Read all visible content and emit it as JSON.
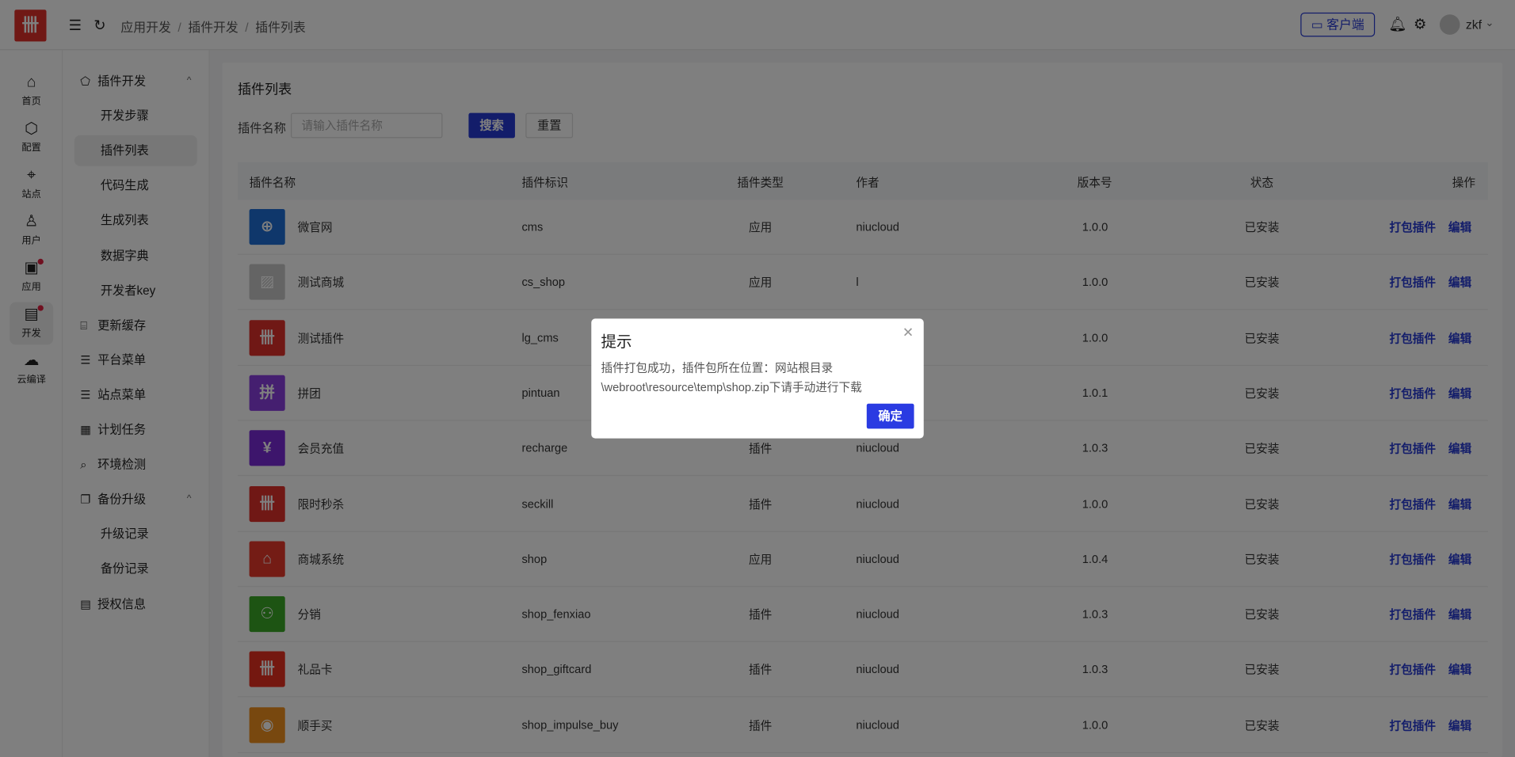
{
  "header": {
    "logo": "卌",
    "breadcrumb": [
      "应用开发",
      "插件开发",
      "插件列表"
    ],
    "client_button": "客户端",
    "username": "zkf"
  },
  "iconbar": [
    {
      "label": "首页",
      "icon": "home-icon",
      "glyph": "⌂"
    },
    {
      "label": "配置",
      "icon": "settings-hex-icon",
      "glyph": "⬡"
    },
    {
      "label": "站点",
      "icon": "location-icon",
      "glyph": "⌖"
    },
    {
      "label": "用户",
      "icon": "user-icon",
      "glyph": "♙"
    },
    {
      "label": "应用",
      "icon": "apps-icon",
      "glyph": "▣",
      "dot": true
    },
    {
      "label": "开发",
      "icon": "dev-icon",
      "glyph": "▤",
      "dot": true,
      "active": true
    },
    {
      "label": "云编译",
      "icon": "cloud-icon",
      "glyph": "☁"
    }
  ],
  "menu": [
    {
      "label": "插件开发",
      "type": "top",
      "icon": "plugin-icon",
      "glyph": "⬠",
      "caret": "^"
    },
    {
      "label": "开发步骤",
      "type": "sub"
    },
    {
      "label": "插件列表",
      "type": "sub",
      "active": true
    },
    {
      "label": "代码生成",
      "type": "sub"
    },
    {
      "label": "生成列表",
      "type": "sub"
    },
    {
      "label": "数据字典",
      "type": "sub"
    },
    {
      "label": "开发者key",
      "type": "sub"
    },
    {
      "label": "更新缓存",
      "type": "top",
      "icon": "cache-icon",
      "glyph": "⌸"
    },
    {
      "label": "平台菜单",
      "type": "top",
      "icon": "list-icon",
      "glyph": "☰"
    },
    {
      "label": "站点菜单",
      "type": "top",
      "icon": "list-icon",
      "glyph": "☰"
    },
    {
      "label": "计划任务",
      "type": "top",
      "icon": "calendar-icon",
      "glyph": "▦"
    },
    {
      "label": "环境检测",
      "type": "top",
      "icon": "search-icon",
      "glyph": "⌕"
    },
    {
      "label": "备份升级",
      "type": "top",
      "icon": "copy-icon",
      "glyph": "❐",
      "caret": "^"
    },
    {
      "label": "升级记录",
      "type": "sub"
    },
    {
      "label": "备份记录",
      "type": "sub"
    },
    {
      "label": "授权信息",
      "type": "top",
      "icon": "doc-icon",
      "glyph": "▤"
    }
  ],
  "main": {
    "title": "插件列表",
    "search_label": "插件名称",
    "search_placeholder": "请输入插件名称",
    "search_button": "搜索",
    "reset_button": "重置",
    "columns": [
      "插件名称",
      "插件标识",
      "插件类型",
      "作者",
      "版本号",
      "状态",
      "操作"
    ],
    "rows": [
      {
        "name": "微官网",
        "key": "cms",
        "type": "应用",
        "author": "niucloud",
        "version": "1.0.0",
        "status": "已安装",
        "color": "#1f6fd6",
        "glyph": "⊕"
      },
      {
        "name": "测试商城",
        "key": "cs_shop",
        "type": "应用",
        "author": "l",
        "version": "1.0.0",
        "status": "已安装",
        "color": "#c9c9c9",
        "glyph": "▨"
      },
      {
        "name": "测试插件",
        "key": "lg_cms",
        "type": "",
        "author": "",
        "version": "1.0.0",
        "status": "已安装",
        "color": "#e0302a",
        "glyph": "卌"
      },
      {
        "name": "拼团",
        "key": "pintuan",
        "type": "",
        "author": "",
        "version": "1.0.1",
        "status": "已安装",
        "color": "#8a3fe0",
        "glyph": "拼"
      },
      {
        "name": "会员充值",
        "key": "recharge",
        "type": "插件",
        "author": "niucloud",
        "version": "1.0.3",
        "status": "已安装",
        "color": "#7a2ad8",
        "glyph": "¥"
      },
      {
        "name": "限时秒杀",
        "key": "seckill",
        "type": "插件",
        "author": "niucloud",
        "version": "1.0.0",
        "status": "已安装",
        "color": "#e0302a",
        "glyph": "卌"
      },
      {
        "name": "商城系统",
        "key": "shop",
        "type": "应用",
        "author": "niucloud",
        "version": "1.0.4",
        "status": "已安装",
        "color": "#e8382a",
        "glyph": "⌂"
      },
      {
        "name": "分销",
        "key": "shop_fenxiao",
        "type": "插件",
        "author": "niucloud",
        "version": "1.0.3",
        "status": "已安装",
        "color": "#3aa826",
        "glyph": "⚇"
      },
      {
        "name": "礼品卡",
        "key": "shop_giftcard",
        "type": "插件",
        "author": "niucloud",
        "version": "1.0.3",
        "status": "已安装",
        "color": "#e83020",
        "glyph": "卌"
      },
      {
        "name": "顺手买",
        "key": "shop_impulse_buy",
        "type": "插件",
        "author": "niucloud",
        "version": "1.0.0",
        "status": "已安装",
        "color": "#f0901e",
        "glyph": "◉"
      }
    ],
    "actions": {
      "pack": "打包插件",
      "edit": "编辑"
    }
  },
  "dialog": {
    "title": "提示",
    "message_line1": "插件打包成功，插件包所在位置：网站根目录",
    "message_line2": "\\webroot\\resource\\temp\\shop.zip下请手动进行下载",
    "ok": "确定"
  }
}
